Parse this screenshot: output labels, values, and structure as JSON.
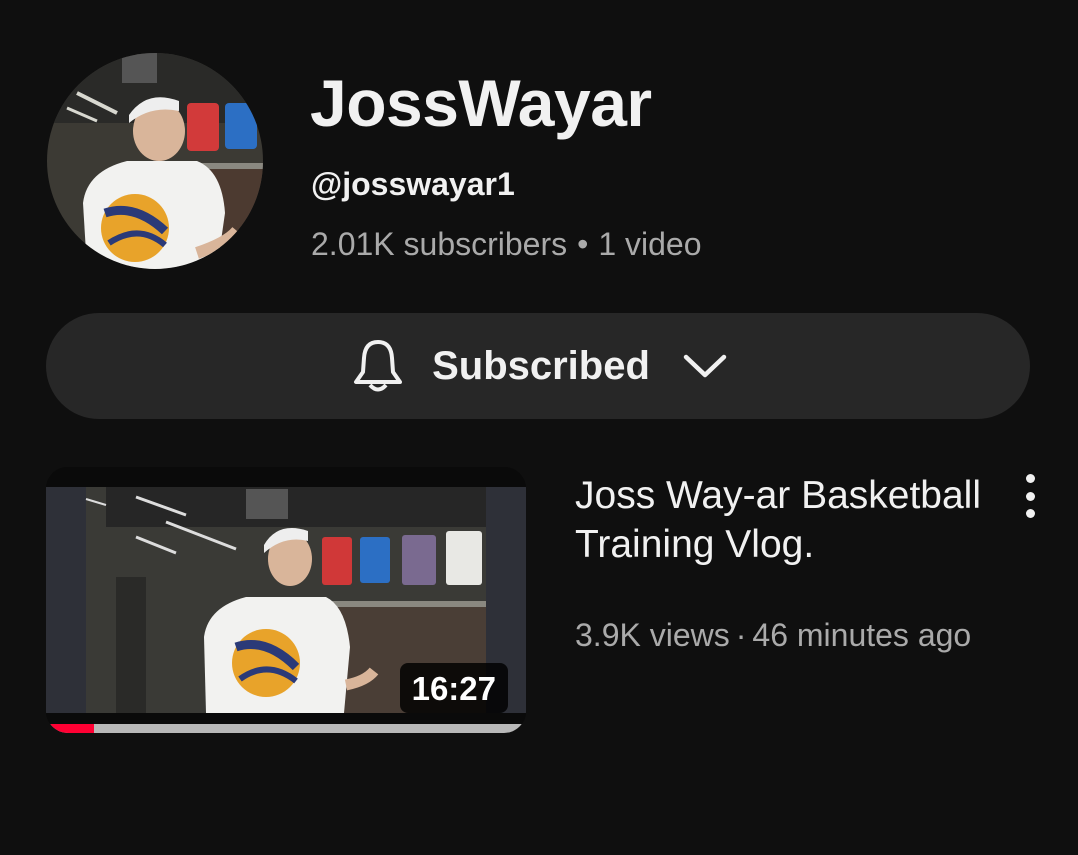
{
  "channel": {
    "name": "JossWayar",
    "handle": "@josswayar1",
    "subscribers": "2.01K subscribers",
    "separator": "•",
    "video_count": "1 video"
  },
  "subscribe": {
    "label": "Subscribed",
    "icon": "bell-icon",
    "dropdown_icon": "chevron-down-icon"
  },
  "video": {
    "title": "Joss Way-ar Basketball Training Vlog.",
    "views": "3.9K views",
    "separator": "·",
    "age": "46 minutes ago",
    "duration": "16:27",
    "watch_progress": 0.1,
    "menu_icon": "more-vert-icon"
  },
  "colors": {
    "background": "#0f0f0f",
    "pill": "#272727",
    "primary_text": "#f1f1f1",
    "secondary_text": "#aaaaaa",
    "progress": "#ff0033"
  }
}
